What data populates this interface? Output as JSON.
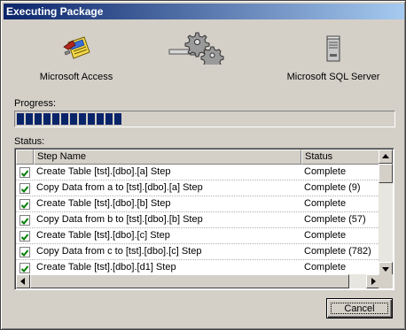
{
  "window": {
    "title": "Executing Package"
  },
  "source": {
    "label": "Microsoft Access",
    "icon": "access-database-icon"
  },
  "transfer": {
    "icon": "gears-transfer-icon"
  },
  "destination": {
    "label": "Microsoft SQL Server",
    "icon": "sql-server-icon"
  },
  "progress": {
    "label": "Progress:",
    "fraction": 0.28
  },
  "status": {
    "label": "Status:",
    "columns": [
      "",
      "Step Name",
      "Status"
    ],
    "rows": [
      {
        "checked": true,
        "step": "Create Table [tst].[dbo].[a] Step",
        "status": "Complete"
      },
      {
        "checked": true,
        "step": "Copy Data from a to [tst].[dbo].[a] Step",
        "status": "Complete (9)"
      },
      {
        "checked": true,
        "step": "Create Table [tst].[dbo].[b] Step",
        "status": "Complete"
      },
      {
        "checked": true,
        "step": "Copy Data from b to [tst].[dbo].[b] Step",
        "status": "Complete (57)"
      },
      {
        "checked": true,
        "step": "Create Table [tst].[dbo].[c] Step",
        "status": "Complete"
      },
      {
        "checked": true,
        "step": "Copy Data from c to [tst].[dbo].[c] Step",
        "status": "Complete (782)"
      },
      {
        "checked": true,
        "step": "Create Table [tst].[dbo].[d1] Step",
        "status": "Complete"
      }
    ]
  },
  "buttons": {
    "cancel": "Cancel"
  },
  "colors": {
    "titlebar_start": "#0a246a",
    "titlebar_end": "#a6caf0",
    "progress_block": "#0a246a",
    "check": "#008000"
  }
}
